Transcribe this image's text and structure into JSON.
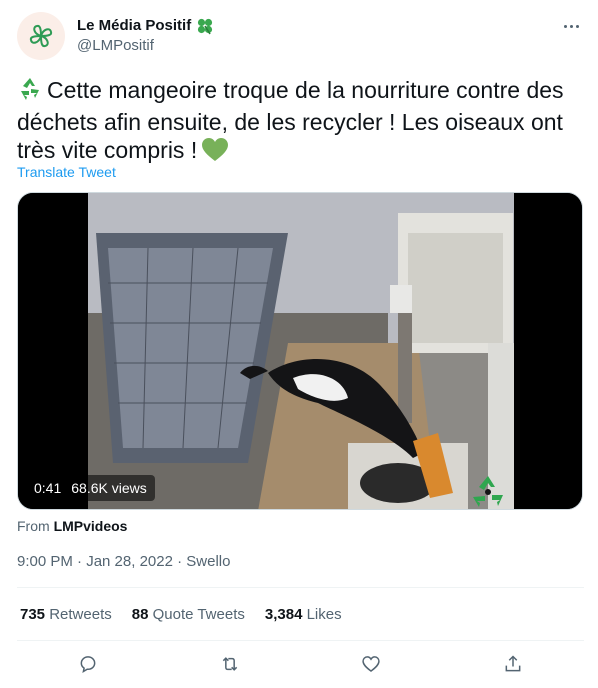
{
  "author": {
    "display_name": "Le Média Positif",
    "handle": "@LMPositif",
    "badge_icon": "four-leaf-clover-icon",
    "avatar_icon": "clover-logo-icon"
  },
  "tweet": {
    "text": "Cette mangeoire troque de la nourriture contre des déchets afin ensuite, de les recycler ! Les oiseaux ont très vite compris !",
    "leading_emoji": "recycling-icon",
    "trailing_emoji": "green-heart-icon",
    "translate_label": "Translate Tweet"
  },
  "media": {
    "duration": "0:41",
    "views": "68.6K views",
    "watermark_icon": "recycle-bird-logo-icon"
  },
  "source": {
    "prefix": "From",
    "name": "LMPvideos"
  },
  "meta": {
    "timestamp": "9:00 PM · Jan 28, 2022 · Swello"
  },
  "stats": {
    "retweets_count": "735",
    "retweets_label": "Retweets",
    "quotes_count": "88",
    "quotes_label": "Quote Tweets",
    "likes_count": "3,384",
    "likes_label": "Likes"
  },
  "colors": {
    "accent": "#1d9bf0",
    "secondary_text": "#536471",
    "clover_green": "#3aa84f"
  }
}
